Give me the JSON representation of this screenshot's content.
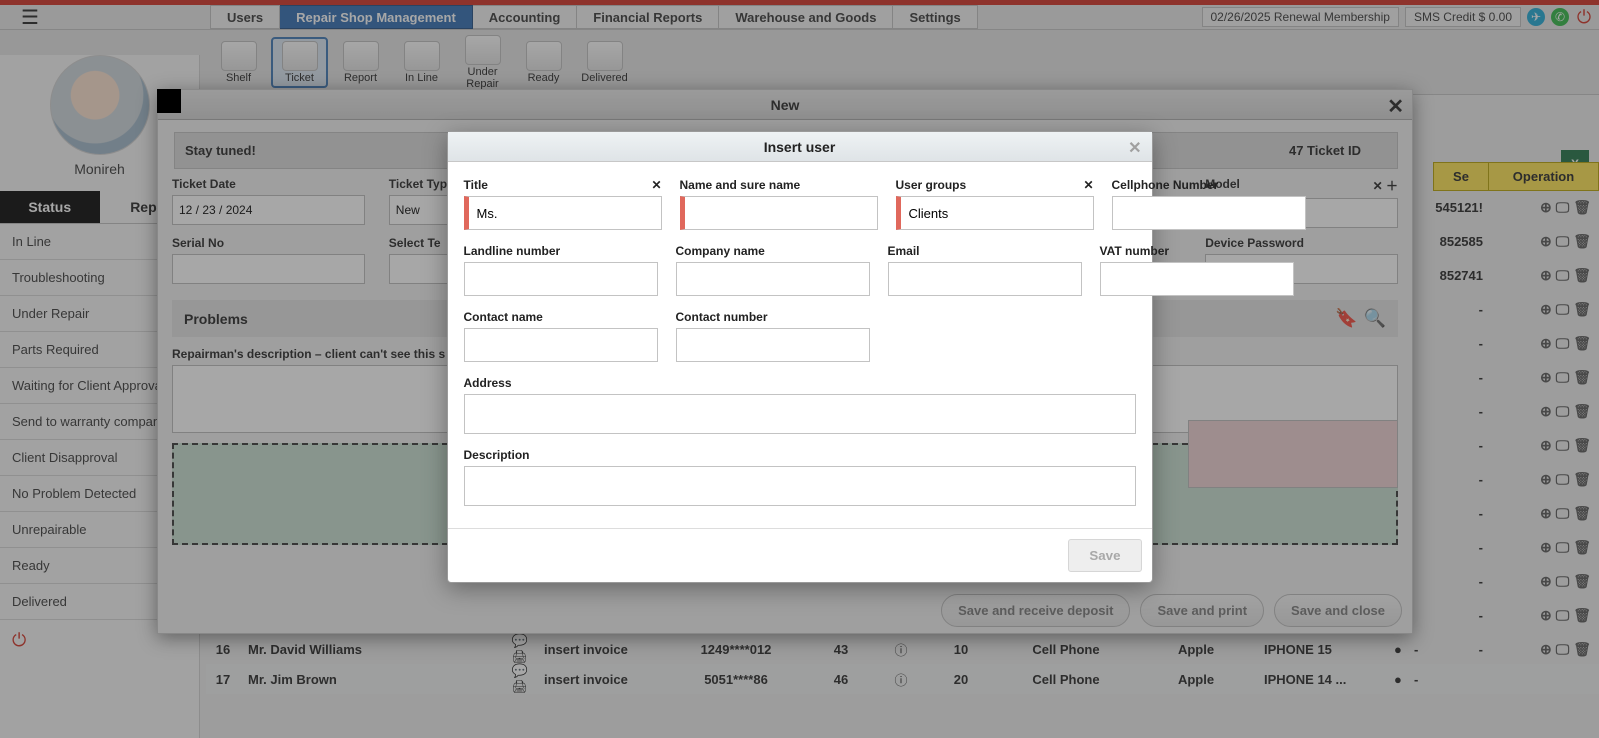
{
  "topbar": {
    "tabs": [
      "Users",
      "Repair Shop Management",
      "Accounting",
      "Financial Reports",
      "Warehouse and Goods",
      "Settings"
    ],
    "active_tab_index": 1,
    "renewal": "02/26/2025 Renewal Membership",
    "sms_credit": "SMS Credit $ 0.00"
  },
  "ribbon": {
    "items": [
      "Shelf",
      "Ticket",
      "Report",
      "In Line",
      "Under Repair",
      "Ready",
      "Delivered"
    ],
    "active_index": 1
  },
  "sidebar": {
    "username": "Monireh",
    "status_headers": {
      "left": "Status",
      "right": "Repai"
    },
    "statuses": [
      "In Line",
      "Troubleshooting",
      "Under Repair",
      "Parts Required",
      "Waiting for Client Approval",
      "Send to warranty company",
      "Client Disapproval",
      "No Problem Detected",
      "Unrepairable",
      "Ready",
      "Delivered"
    ]
  },
  "grid": {
    "col_se": "Se",
    "col_op": "Operation",
    "rows_right": [
      "545121!",
      "852585",
      "852741",
      "-",
      "-",
      "-",
      "-",
      "-",
      "-",
      "-",
      "-",
      "-",
      "-",
      "-",
      "-"
    ]
  },
  "bottom_rows": [
    {
      "n": "16",
      "name": "Mr. David Williams",
      "inv": "insert invoice",
      "code": "1249****012",
      "a": "43",
      "b": "10",
      "cat": "Cell Phone",
      "brand": "Apple",
      "model": "IPHONE 15",
      "dot": true,
      "dash": "-"
    },
    {
      "n": "17",
      "name": "Mr. Jim Brown",
      "inv": "insert invoice",
      "code": "5051****86",
      "a": "46",
      "b": "20",
      "cat": "Cell Phone",
      "brand": "Apple",
      "model": "IPHONE 14 ...",
      "dot": true,
      "dash": "-"
    }
  ],
  "modal_new": {
    "title": "New",
    "stay_tuned": "Stay tuned!",
    "ticket_id_label": "47 Ticket ID",
    "fields": {
      "ticket_date": {
        "label": "Ticket Date",
        "value": "12 / 23 / 2024"
      },
      "ticket_type": {
        "label": "Ticket Type",
        "value": "New"
      },
      "model": {
        "label": "Model"
      },
      "serial_no": {
        "label": "Serial No"
      },
      "select_te": {
        "label": "Select Te"
      },
      "device_password": {
        "label": "Device Password"
      }
    },
    "problems_label": "Problems",
    "repairman_label": "Repairman's description – client can't see this s",
    "buttons": {
      "dep": "Save and receive deposit",
      "print": "Save and print",
      "close": "Save and close"
    }
  },
  "modal_user": {
    "title": "Insert user",
    "fields": {
      "title": {
        "label": "Title",
        "value": "Ms."
      },
      "name": {
        "label": "Name and sure name"
      },
      "groups": {
        "label": "User groups",
        "value": "Clients"
      },
      "cell": {
        "label": "Cellphone Number"
      },
      "landline": {
        "label": "Landline number"
      },
      "company": {
        "label": "Company name"
      },
      "email": {
        "label": "Email"
      },
      "vat": {
        "label": "VAT number"
      },
      "contact_name": {
        "label": "Contact name"
      },
      "contact_number": {
        "label": "Contact number"
      },
      "address": {
        "label": "Address"
      },
      "description": {
        "label": "Description"
      }
    },
    "save": "Save"
  }
}
